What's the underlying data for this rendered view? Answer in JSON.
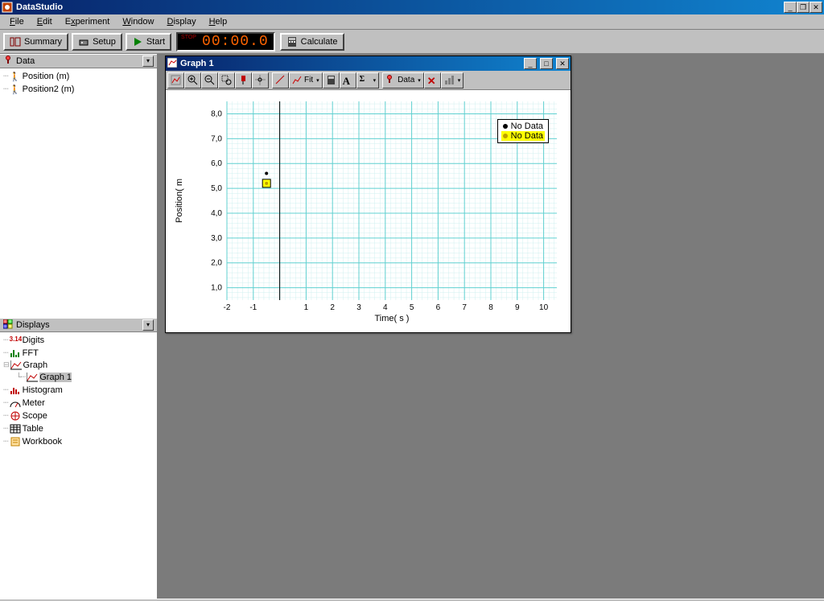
{
  "titlebar": {
    "title": "DataStudio"
  },
  "menubar": {
    "file": "File",
    "edit": "Edit",
    "experiment": "Experiment",
    "window": "Window",
    "display": "Display",
    "help": "Help"
  },
  "toolbar": {
    "summary": "Summary",
    "setup": "Setup",
    "start": "Start",
    "calculate": "Calculate",
    "timer": "00:00.0",
    "stop": "STOP"
  },
  "sidebar": {
    "data_header": "Data",
    "data_items": [
      {
        "label": "Position (m)"
      },
      {
        "label": "Position2 (m)"
      }
    ],
    "displays_header": "Displays",
    "displays_items": [
      {
        "icon": "digits",
        "label": "Digits"
      },
      {
        "icon": "fft",
        "label": "FFT"
      },
      {
        "icon": "graph",
        "label": "Graph",
        "expanded": true,
        "children": [
          {
            "label": "Graph 1",
            "selected": true
          }
        ]
      },
      {
        "icon": "histogram",
        "label": "Histogram"
      },
      {
        "icon": "meter",
        "label": "Meter"
      },
      {
        "icon": "scope",
        "label": "Scope"
      },
      {
        "icon": "table",
        "label": "Table"
      },
      {
        "icon": "workbook",
        "label": "Workbook"
      }
    ]
  },
  "graph_window": {
    "title": "Graph 1",
    "toolbar": {
      "fit": "Fit",
      "data": "Data"
    },
    "legend": [
      {
        "color": "#000000",
        "label": "No Data",
        "highlighted": false
      },
      {
        "color": "#c0a000",
        "label": "No Data",
        "highlighted": true
      }
    ]
  },
  "chart_data": {
    "type": "scatter",
    "title": "",
    "xlabel": "Time( s )",
    "ylabel": "Position( m",
    "xlim": [
      -2,
      10.5
    ],
    "ylim": [
      0.5,
      8.5
    ],
    "xticks": [
      -2,
      -1,
      1,
      2,
      3,
      4,
      5,
      6,
      7,
      8,
      9,
      10
    ],
    "yticks": [
      1.0,
      2.0,
      3.0,
      4.0,
      5.0,
      6.0,
      7.0,
      8.0
    ],
    "ytick_labels": [
      "1,0",
      "2,0",
      "3,0",
      "4,0",
      "5,0",
      "6,0",
      "7,0",
      "8,0"
    ],
    "series": [
      {
        "name": "No Data",
        "color": "#000000",
        "values": []
      },
      {
        "name": "No Data",
        "color": "#c0a000",
        "values": []
      }
    ],
    "annotations": [
      {
        "type": "point",
        "x": -0.5,
        "y": 5.6,
        "color": "#000000"
      },
      {
        "type": "marker",
        "x": -0.5,
        "y": 5.2,
        "fill": "#ffff00",
        "stroke": "#000000"
      }
    ]
  }
}
